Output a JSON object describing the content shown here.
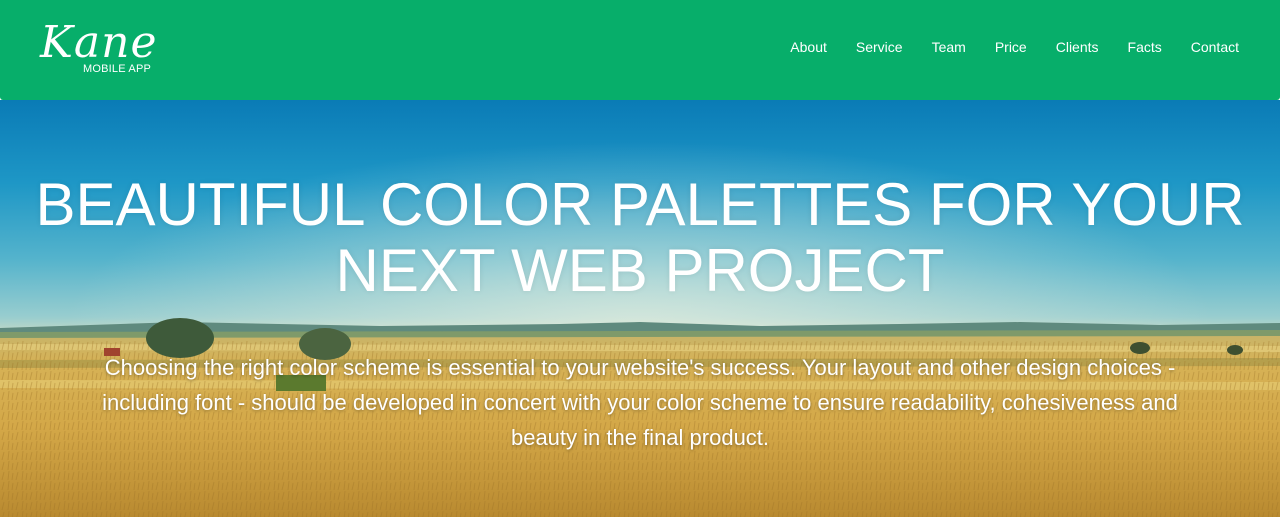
{
  "brand": {
    "logo_script": "Kane",
    "logo_subtitle": "MOBILE APP"
  },
  "nav": {
    "items": [
      {
        "label": "About"
      },
      {
        "label": "Service"
      },
      {
        "label": "Team"
      },
      {
        "label": "Price"
      },
      {
        "label": "Clients"
      },
      {
        "label": "Facts"
      },
      {
        "label": "Contact"
      }
    ]
  },
  "hero": {
    "title": "BEAUTIFUL COLOR PALETTES FOR YOUR NEXT WEB PROJECT",
    "description": "Choosing the right color scheme is essential to your website's success. Your layout and other design choices - including font - should be developed in concert with your color scheme to ensure readability, cohesiveness and beauty in the final product.",
    "background_image": "wheat-field-under-blue-sky"
  },
  "colors": {
    "navbar_bg": "#07ae6a",
    "nav_text": "#ffffff",
    "sky_top": "#0a7bb6",
    "field": "#d8b25a"
  }
}
